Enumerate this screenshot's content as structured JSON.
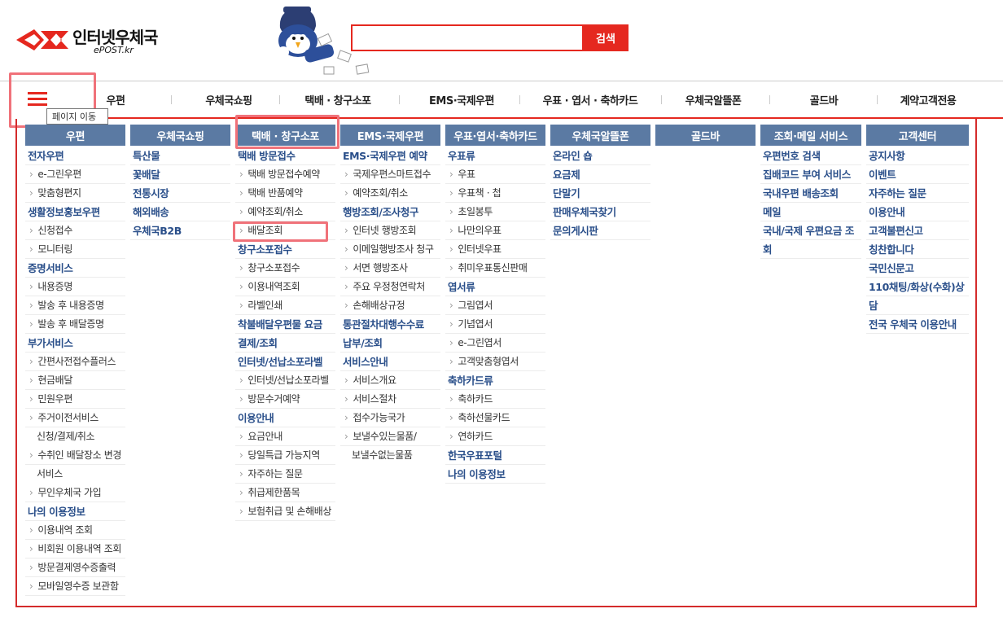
{
  "header": {
    "logo_ko": "인터넷우체국",
    "logo_en": "ePOST.kr",
    "search_placeholder": "",
    "search_button": "검색"
  },
  "colors": {
    "accent": "#e5281f",
    "column_header": "#5b7aa3",
    "link_blue": "#2a4f8a",
    "highlight": "#f0727a"
  },
  "gnb": {
    "menu_icon": "hamburger-icon",
    "tooltip": "페이지 이동",
    "items": [
      "우편",
      "우체국쇼핑",
      "택배 · 창구소포",
      "EMS·국제우편",
      "우표 · 엽서 · 축하카드",
      "우체국알뜰폰",
      "골드바",
      "계약고객전용"
    ]
  },
  "sitemap": [
    {
      "title": "우편",
      "items": [
        {
          "t": "전자우편",
          "d": 1
        },
        {
          "t": "e-그린우편",
          "d": 2
        },
        {
          "t": "맞춤형편지",
          "d": 2
        },
        {
          "t": "생활정보홍보우편",
          "d": 1
        },
        {
          "t": "신청접수",
          "d": 2
        },
        {
          "t": "모니터링",
          "d": 2
        },
        {
          "t": "증명서비스",
          "d": 1
        },
        {
          "t": "내용증명",
          "d": 2
        },
        {
          "t": "발송 후 내용증명",
          "d": 2
        },
        {
          "t": "발송 후 배달증명",
          "d": 2
        },
        {
          "t": "부가서비스",
          "d": 1
        },
        {
          "t": "간편사전접수플러스",
          "d": 2
        },
        {
          "t": "현금배달",
          "d": 2
        },
        {
          "t": "민원우편",
          "d": 2
        },
        {
          "t": "주거이전서비스",
          "d": 2
        },
        {
          "t": "신청/결제/취소",
          "d": 3
        },
        {
          "t": "수취인 배달장소 변경",
          "d": 2
        },
        {
          "t": "서비스",
          "d": 3
        },
        {
          "t": "무인우체국 가입",
          "d": 2
        },
        {
          "t": "나의 이용정보",
          "d": 1
        },
        {
          "t": "이용내역 조회",
          "d": 2
        },
        {
          "t": "비회원 이용내역 조회",
          "d": 2
        },
        {
          "t": "방문결제영수증출력",
          "d": 2
        },
        {
          "t": "모바일영수증 보관함",
          "d": 2
        }
      ]
    },
    {
      "title": "우체국쇼핑",
      "items": [
        {
          "t": "특산물",
          "d": 1
        },
        {
          "t": "꽃배달",
          "d": 1
        },
        {
          "t": "전통시장",
          "d": 1
        },
        {
          "t": "해외배송",
          "d": 1
        },
        {
          "t": "우체국B2B",
          "d": 1
        }
      ]
    },
    {
      "title": "택배 · 창구소포",
      "items": [
        {
          "t": "택배 방문접수",
          "d": 1
        },
        {
          "t": "택배 방문접수예약",
          "d": 2
        },
        {
          "t": "택배 반품예약",
          "d": 2
        },
        {
          "t": "예약조회/취소",
          "d": 2
        },
        {
          "t": "배달조회",
          "d": 2
        },
        {
          "t": "창구소포접수",
          "d": 1
        },
        {
          "t": "창구소포접수",
          "d": 2
        },
        {
          "t": "이용내역조회",
          "d": 2
        },
        {
          "t": "라벨인쇄",
          "d": 2
        },
        {
          "t": "착불배달우편물 요금",
          "d": 1
        },
        {
          "t": "결제/조회",
          "d": 1
        },
        {
          "t": "인터넷/선납소포라벨",
          "d": 1
        },
        {
          "t": "인터넷/선납소포라벨",
          "d": 2
        },
        {
          "t": "방문수거예약",
          "d": 2
        },
        {
          "t": "이용안내",
          "d": 1
        },
        {
          "t": "요금안내",
          "d": 2
        },
        {
          "t": "당일특급 가능지역",
          "d": 2
        },
        {
          "t": "자주하는 질문",
          "d": 2
        },
        {
          "t": "취급제한품목",
          "d": 2
        },
        {
          "t": "보험취급 및 손해배상",
          "d": 2
        }
      ]
    },
    {
      "title": "EMS·국제우편",
      "items": [
        {
          "t": "EMS·국제우편 예약",
          "d": 1
        },
        {
          "t": "국제우편스마트접수",
          "d": 2
        },
        {
          "t": "예약조회/취소",
          "d": 2
        },
        {
          "t": "행방조회/조사청구",
          "d": 1
        },
        {
          "t": "인터넷 행방조회",
          "d": 2
        },
        {
          "t": "이메일행방조사 청구",
          "d": 2
        },
        {
          "t": "서면 행방조사",
          "d": 2
        },
        {
          "t": "주요 우정청연락처",
          "d": 2
        },
        {
          "t": "손해배상규정",
          "d": 2
        },
        {
          "t": "통관절차대행수수료",
          "d": 1
        },
        {
          "t": "납부/조회",
          "d": 1
        },
        {
          "t": "서비스안내",
          "d": 1
        },
        {
          "t": "서비스개요",
          "d": 2
        },
        {
          "t": "서비스절차",
          "d": 2
        },
        {
          "t": "접수가능국가",
          "d": 2
        },
        {
          "t": "보낼수있는물품/",
          "d": 2
        },
        {
          "t": "보낼수없는물품",
          "d": 3
        }
      ]
    },
    {
      "title": "우표·엽서·축하카드",
      "items": [
        {
          "t": "우표류",
          "d": 1
        },
        {
          "t": "우표",
          "d": 2
        },
        {
          "t": "우표책 · 첩",
          "d": 2
        },
        {
          "t": "초일봉투",
          "d": 2
        },
        {
          "t": "나만의우표",
          "d": 2
        },
        {
          "t": "인터넷우표",
          "d": 2
        },
        {
          "t": "취미우표통신판매",
          "d": 2
        },
        {
          "t": "엽서류",
          "d": 1
        },
        {
          "t": "그림엽서",
          "d": 2
        },
        {
          "t": "기념엽서",
          "d": 2
        },
        {
          "t": "e-그린엽서",
          "d": 2
        },
        {
          "t": "고객맞춤형엽서",
          "d": 2
        },
        {
          "t": "축하카드류",
          "d": 1
        },
        {
          "t": "축하카드",
          "d": 2
        },
        {
          "t": "축하선물카드",
          "d": 2
        },
        {
          "t": "연하카드",
          "d": 2
        },
        {
          "t": "한국우표포털",
          "d": 1
        },
        {
          "t": "나의 이용정보",
          "d": 1
        }
      ]
    },
    {
      "title": "우체국알뜰폰",
      "items": [
        {
          "t": "온라인 숍",
          "d": 1
        },
        {
          "t": "요금제",
          "d": 1
        },
        {
          "t": "단말기",
          "d": 1
        },
        {
          "t": "판매우체국찾기",
          "d": 1
        },
        {
          "t": "문의게시판",
          "d": 1
        }
      ]
    },
    {
      "title": "골드바",
      "items": []
    },
    {
      "title": "조회·메일 서비스",
      "items": [
        {
          "t": "우편번호 검색",
          "d": 1
        },
        {
          "t": "집배코드 부여 서비스",
          "d": 1
        },
        {
          "t": "국내우편 배송조회",
          "d": 1
        },
        {
          "t": "메일",
          "d": 1
        },
        {
          "t": "국내/국제 우편요금 조",
          "d": 1
        },
        {
          "t": "회",
          "d": 1
        }
      ]
    },
    {
      "title": "고객센터",
      "items": [
        {
          "t": "공지사항",
          "d": 1
        },
        {
          "t": "이벤트",
          "d": 1
        },
        {
          "t": "자주하는 질문",
          "d": 1
        },
        {
          "t": "이용안내",
          "d": 1
        },
        {
          "t": "고객불편신고",
          "d": 1
        },
        {
          "t": "칭찬합니다",
          "d": 1
        },
        {
          "t": "국민신문고",
          "d": 1
        },
        {
          "t": "110채팅/화상(수화)상",
          "d": 1
        },
        {
          "t": "담",
          "d": 1
        },
        {
          "t": "전국 우체국 이용안내",
          "d": 1
        }
      ]
    }
  ]
}
